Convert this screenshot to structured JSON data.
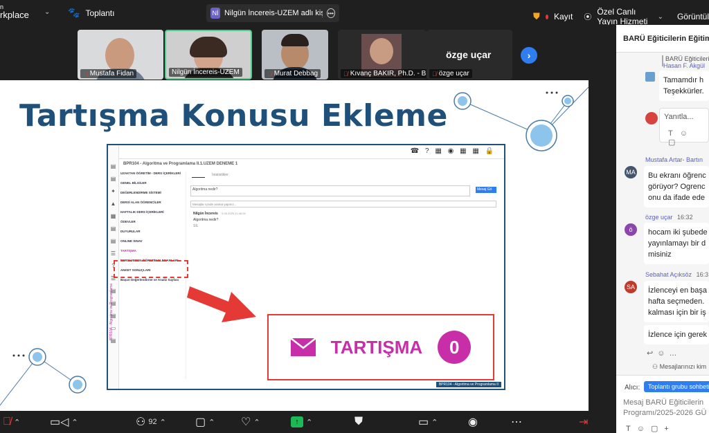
{
  "topbar": {
    "brand_line1": "n",
    "brand_line2": "rkplace",
    "meeting_label": "Toplantı",
    "chat_tab_initials": "Nİ",
    "chat_tab_label": "Nilgün İncereis-UZEM adlı kişinin",
    "record_label": "Kayıt",
    "live_label": "Özel Canlı Yayın Hizmeti",
    "view_label": "Görüntül"
  },
  "participants": [
    {
      "name": "Mustafa Fidan",
      "muted": true
    },
    {
      "name": "Nilgün İncereis-UZEM",
      "muted": false
    },
    {
      "name": "Murat Debbag",
      "muted": true
    },
    {
      "name": "Kıvanç BAKIR, Ph.D. - B...",
      "muted": true
    },
    {
      "name": "özge uçar",
      "muted": true,
      "display_text": "özge uçar"
    }
  ],
  "slide": {
    "title": "Tartışma Konusu Ekleme",
    "lms": {
      "breadcrumb": "BPR104 - Algoritma ve Programlama II.1.UZEM DENEME 1",
      "menu": [
        "UZAKTAN ÖĞRETİM - DERS İÇERİKLERİ",
        "GENEL BİLGİLER",
        "DEĞERLENDİRME SİSTEMİ",
        "DERSİ ALAN ÖĞRENCİLER",
        "HAFTALIK DERS İÇERİKLERİ",
        "ÖDEVLER",
        "DUYURULAR",
        "ONLINE SINAV",
        "TARTIŞMA",
        "DERSİ VEREN ÖĞRETİM ELEMANLARI",
        "ANKET SONUÇLARI",
        "Başarı Değerlendirme ve Analiz Sayfası"
      ],
      "tab1": "Tartışma",
      "tab2": "İstatistikler",
      "question_placeholder": "Algoritma nedir?",
      "send_button": "Mesaj Gö",
      "search_placeholder": "Mesajlar içinde arama yapınız...",
      "post_author": "Nilgün İncereis",
      "post_date": "5.05.2025 21:46:00",
      "post_text": "Algoritma nedir?",
      "post_action": "SİL",
      "side_label": "BPR104 - Algoritma ve Programlama",
      "footer_label": "BPR104 - Algoritma ve Programlama II"
    },
    "zoom_label": "TARTIŞMA",
    "zoom_count": "0"
  },
  "chat": {
    "title": "BARÜ Eğiticilerin Eğitimi P",
    "quote_label": "BARÜ Eğiticileri",
    "quote_author": "Hasan F. Akgül",
    "msg1_line1": "Tamamdır h",
    "msg1_line2": "Teşekkürler.",
    "reply_placeholder": "Yanıtla...",
    "msg2_name": "Mustafa Artar- Bartın",
    "msg2_initials": "MA",
    "msg2_lines": [
      "Bu ekranı öğrenc",
      "görüyor? Ogrenc",
      "onu da ifade ede"
    ],
    "msg3_name": "özge uçar",
    "msg3_time": "16:32",
    "msg3_initials": "ö",
    "msg3_lines": [
      "hocam iki şubede",
      "yayınlamayı bir d",
      "misiniz"
    ],
    "msg4_name": "Sebahat Açıksöz",
    "msg4_time": "16:3",
    "msg4_initials": "SA",
    "msg4_lines": [
      "İzlenceyi en başa",
      "hafta seçmeden.",
      "kalması için bir iş"
    ],
    "msg5_line": "İzlence için gerek",
    "seen_label": "Mesajlarınızı kim",
    "to_label": "Alıcı:",
    "to_chip": "Toplantı grubu sohbeti",
    "compose_line1": "Mesaj BARÜ Eğiticilerin",
    "compose_line2": "Programı/2025-2026 GÜ"
  },
  "bottombar": {
    "participants_count": "92"
  },
  "colors": {
    "accent": "#5b5fc7",
    "slide_title": "#1e5079",
    "magenta": "#c72ea8",
    "red": "#e53935"
  }
}
